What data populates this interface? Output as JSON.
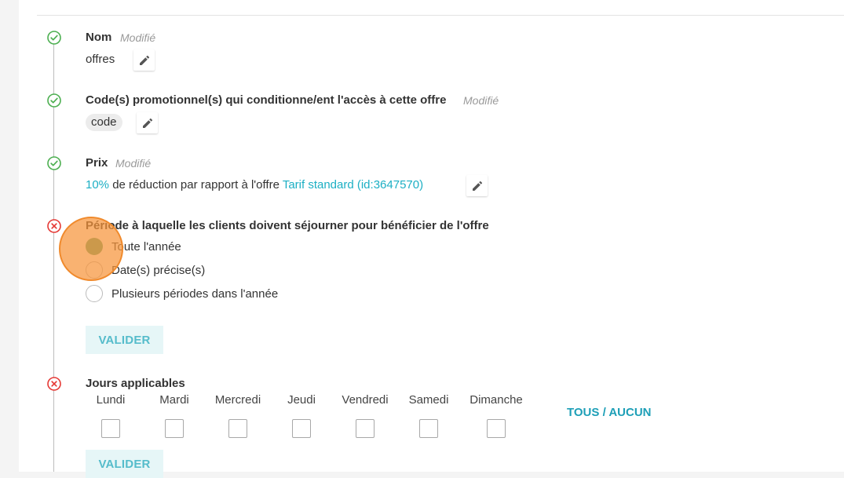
{
  "sections": {
    "nom": {
      "title": "Nom",
      "modified": "Modifié",
      "value": "offres",
      "status": "valid",
      "status_icon": "check-circle-icon",
      "edit_icon": "pencil-icon"
    },
    "codes": {
      "title": "Code(s) promotionnel(s) qui conditionne/ent l'accès à cette offre",
      "modified": "Modifié",
      "chip": "code",
      "status": "valid",
      "status_icon": "check-circle-icon",
      "edit_icon": "pencil-icon"
    },
    "prix": {
      "title": "Prix",
      "modified": "Modifié",
      "percent": "10%",
      "middle_text": " de réduction par rapport à l'offre ",
      "offer_link": "Tarif standard (id:3647570)",
      "status": "valid",
      "status_icon": "check-circle-icon",
      "edit_icon": "pencil-icon"
    },
    "periode": {
      "title": "Période à laquelle les clients doivent séjourner pour bénéficier de l'offre",
      "status": "invalid",
      "status_icon": "x-circle-icon",
      "options": [
        {
          "label": "Toute l'année",
          "checked": true
        },
        {
          "label": "Date(s) précise(s)",
          "checked": false
        },
        {
          "label": "Plusieurs périodes dans l'année",
          "checked": false
        }
      ],
      "submit_label": "VALIDER"
    },
    "jours": {
      "title": "Jours applicables",
      "status": "invalid",
      "status_icon": "x-circle-icon",
      "days": [
        "Lundi",
        "Mardi",
        "Mercredi",
        "Jeudi",
        "Vendredi",
        "Samedi",
        "Dimanche"
      ],
      "toggle_all_label": "TOUS / AUCUN",
      "submit_label": "VALIDER"
    }
  },
  "colors": {
    "valid": "#4caf50",
    "invalid": "#e53935",
    "link": "#1cafc4",
    "radio_checked": "#5aa578",
    "highlight": "#f6943a"
  }
}
